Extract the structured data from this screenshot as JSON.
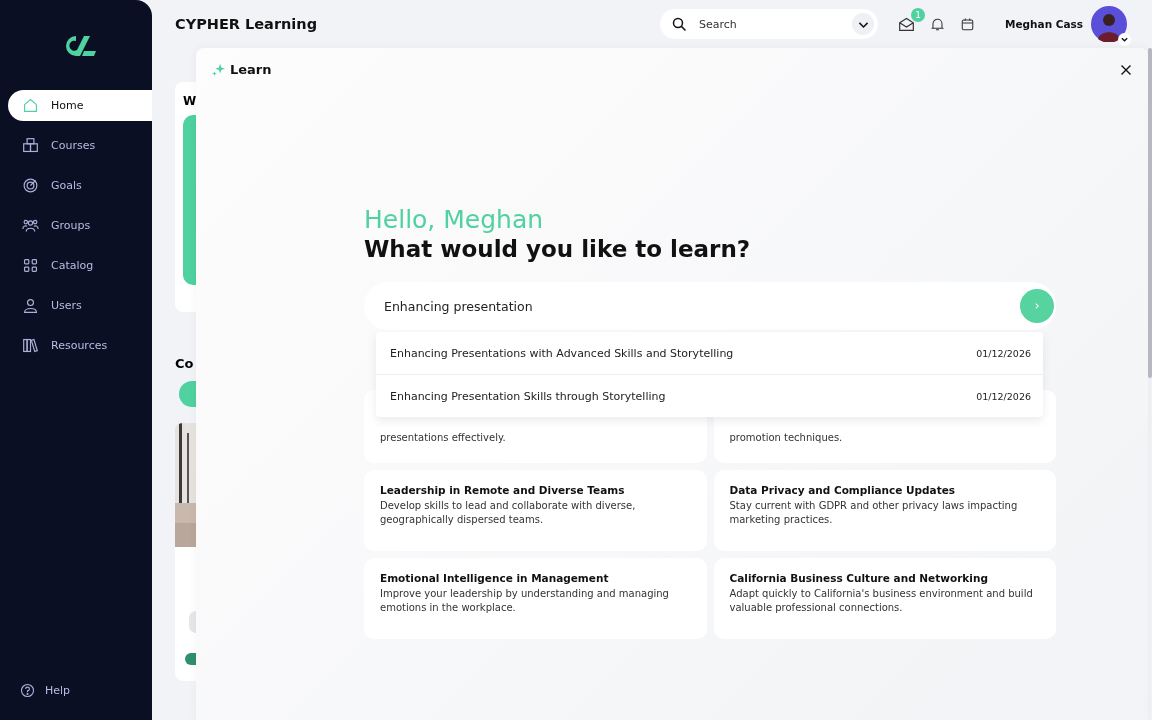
{
  "sidebar": {
    "items": [
      {
        "label": "Home",
        "selected": true
      },
      {
        "label": "Courses",
        "selected": false
      },
      {
        "label": "Goals",
        "selected": false
      },
      {
        "label": "Groups",
        "selected": false
      },
      {
        "label": "Catalog",
        "selected": false
      },
      {
        "label": "Users",
        "selected": false
      },
      {
        "label": "Resources",
        "selected": false
      }
    ],
    "help": "Help"
  },
  "header": {
    "title": "CYPHER Learning",
    "search": {
      "placeholder": "Search"
    },
    "messages_badge": "1",
    "user_name": "Meghan Cass"
  },
  "background": {
    "card_heading": "W",
    "section_heading": "Co"
  },
  "learn": {
    "title": "Learn",
    "greeting": "Hello, Meghan",
    "question": "What would you like to learn?",
    "query": "Enhancing presentation",
    "suggestions": [
      {
        "title": "Enhancing Presentations with Advanced Skills and Storytelling",
        "date": "01/12/2026"
      },
      {
        "title": "Enhancing Presentation Skills through Storytelling",
        "date": "01/12/2026"
      }
    ],
    "topics": [
      {
        "description": "presentations effectively."
      },
      {
        "description": "promotion techniques."
      },
      {
        "title": "Leadership in Remote and Diverse Teams",
        "description": "Develop skills to lead and collaborate with diverse, geographically dispersed teams."
      },
      {
        "title": "Data Privacy and Compliance Updates",
        "description": "Stay current with GDPR and other privacy laws impacting marketing practices."
      },
      {
        "title": "Emotional Intelligence in Management",
        "description": "Improve your leadership by understanding and managing emotions in the workplace."
      },
      {
        "title": "California Business Culture and Networking",
        "description": "Adapt quickly to California's business environment and build valuable professional connections."
      }
    ]
  }
}
